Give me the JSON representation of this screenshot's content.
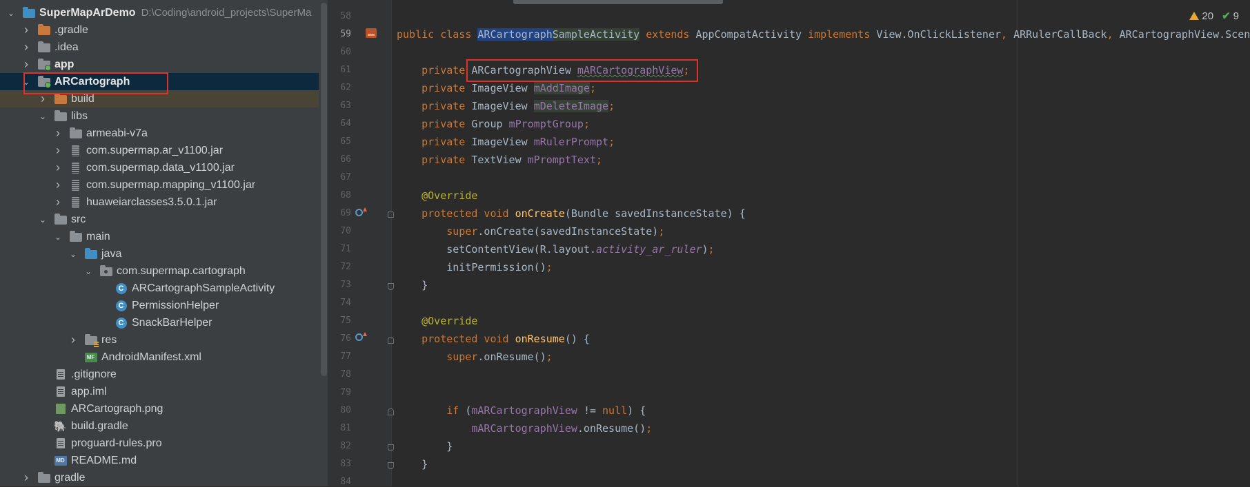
{
  "project_tree": {
    "rows": [
      {
        "label": "SuperMapArDemo",
        "path": "D:\\Coding\\android_projects\\SuperMa",
        "arrow": "down",
        "icon": "folder-blue-icon",
        "bold": true
      },
      {
        "label": ".gradle",
        "arrow": "right",
        "icon": "folder-orange-icon"
      },
      {
        "label": ".idea",
        "arrow": "right",
        "icon": "folder-grey-icon"
      },
      {
        "label": "app",
        "arrow": "right",
        "icon": "module-folder-icon",
        "bold": true
      },
      {
        "label": "ARCartograph",
        "arrow": "down",
        "icon": "module-folder-icon",
        "bold": true
      },
      {
        "label": "build",
        "arrow": "right",
        "icon": "folder-orange-icon"
      },
      {
        "label": "libs",
        "arrow": "down",
        "icon": "folder-grey-icon"
      },
      {
        "label": "armeabi-v7a",
        "arrow": "right",
        "icon": "folder-grey-icon"
      },
      {
        "label": "com.supermap.ar_v1100.jar",
        "arrow": "right",
        "icon": "jar-icon"
      },
      {
        "label": "com.supermap.data_v1100.jar",
        "arrow": "right",
        "icon": "jar-icon"
      },
      {
        "label": "com.supermap.mapping_v1100.jar",
        "arrow": "right",
        "icon": "jar-icon"
      },
      {
        "label": "huaweiarclasses3.5.0.1.jar",
        "arrow": "right",
        "icon": "jar-icon"
      },
      {
        "label": "src",
        "arrow": "down",
        "icon": "folder-grey-icon"
      },
      {
        "label": "main",
        "arrow": "down",
        "icon": "folder-grey-icon"
      },
      {
        "label": "java",
        "arrow": "down",
        "icon": "folder-blue-icon"
      },
      {
        "label": "com.supermap.cartograph",
        "arrow": "down",
        "icon": "package-icon"
      },
      {
        "label": "ARCartographSampleActivity",
        "arrow": "none",
        "icon": "class-icon"
      },
      {
        "label": "PermissionHelper",
        "arrow": "none",
        "icon": "class-icon"
      },
      {
        "label": "SnackBarHelper",
        "arrow": "none",
        "icon": "class-icon"
      },
      {
        "label": "res",
        "arrow": "right",
        "icon": "res-folder-icon"
      },
      {
        "label": "AndroidManifest.xml",
        "arrow": "none",
        "icon": "manifest-icon"
      },
      {
        "label": ".gitignore",
        "arrow": "none",
        "icon": "file-icon"
      },
      {
        "label": "app.iml",
        "arrow": "none",
        "icon": "file-icon"
      },
      {
        "label": "ARCartograph.png",
        "arrow": "none",
        "icon": "image-file-icon"
      },
      {
        "label": "build.gradle",
        "arrow": "none",
        "icon": "gradle-icon"
      },
      {
        "label": "proguard-rules.pro",
        "arrow": "none",
        "icon": "file-icon"
      },
      {
        "label": "README.md",
        "arrow": "none",
        "icon": "markdown-icon"
      },
      {
        "label": "gradle",
        "arrow": "right",
        "icon": "folder-grey-icon"
      }
    ],
    "icon_badges": {
      "mf": "MF",
      "md": "MD",
      "class": "C"
    }
  },
  "editor": {
    "inspections": {
      "warnings": "20",
      "ok": "9"
    },
    "lines": [
      {
        "n": "58",
        "tokens": []
      },
      {
        "n": "59",
        "tokens": [
          [
            "kw",
            "public class "
          ],
          [
            "sel",
            "ARCartograph"
          ],
          [
            "occ",
            "SampleActivity"
          ],
          [
            "kw",
            " extends "
          ],
          [
            "p",
            "AppCompatActivity "
          ],
          [
            "kw",
            "implements "
          ],
          [
            "p",
            "View.OnClickListener"
          ],
          [
            "kw",
            ", "
          ],
          [
            "p",
            "ARRulerCallBack"
          ],
          [
            "kw",
            ", "
          ],
          [
            "p",
            "ARCartographView.Scene"
          ]
        ]
      },
      {
        "n": "60",
        "tokens": []
      },
      {
        "n": "61",
        "tokens": [
          [
            "p",
            "    "
          ],
          [
            "kw",
            "private "
          ],
          [
            "p",
            "ARCartographView "
          ],
          [
            "fldw",
            "mARCartographView"
          ],
          [
            "kw",
            ";"
          ]
        ]
      },
      {
        "n": "62",
        "tokens": [
          [
            "p",
            "    "
          ],
          [
            "kw",
            "private "
          ],
          [
            "p",
            "ImageView "
          ],
          [
            "fldo",
            "mAddImage"
          ],
          [
            "kw",
            ";"
          ]
        ]
      },
      {
        "n": "63",
        "tokens": [
          [
            "p",
            "    "
          ],
          [
            "kw",
            "private "
          ],
          [
            "p",
            "ImageView "
          ],
          [
            "fldo",
            "mDeleteImage"
          ],
          [
            "kw",
            ";"
          ]
        ]
      },
      {
        "n": "64",
        "tokens": [
          [
            "p",
            "    "
          ],
          [
            "kw",
            "private "
          ],
          [
            "p",
            "Group "
          ],
          [
            "fld",
            "mPromptGroup"
          ],
          [
            "kw",
            ";"
          ]
        ]
      },
      {
        "n": "65",
        "tokens": [
          [
            "p",
            "    "
          ],
          [
            "kw",
            "private "
          ],
          [
            "p",
            "ImageView "
          ],
          [
            "fld",
            "mRulerPrompt"
          ],
          [
            "kw",
            ";"
          ]
        ]
      },
      {
        "n": "66",
        "tokens": [
          [
            "p",
            "    "
          ],
          [
            "kw",
            "private "
          ],
          [
            "p",
            "TextView "
          ],
          [
            "fld",
            "mPromptText"
          ],
          [
            "kw",
            ";"
          ]
        ]
      },
      {
        "n": "67",
        "tokens": []
      },
      {
        "n": "68",
        "tokens": [
          [
            "p",
            "    "
          ],
          [
            "ann",
            "@Override"
          ]
        ]
      },
      {
        "n": "69",
        "tokens": [
          [
            "p",
            "    "
          ],
          [
            "kw",
            "protected void "
          ],
          [
            "mth",
            "onCreate"
          ],
          [
            "p",
            "(Bundle savedInstanceState) {"
          ]
        ]
      },
      {
        "n": "70",
        "tokens": [
          [
            "p",
            "        "
          ],
          [
            "kw",
            "super"
          ],
          [
            "p",
            ".onCreate(savedInstanceState)"
          ],
          [
            "kw",
            ";"
          ]
        ]
      },
      {
        "n": "71",
        "tokens": [
          [
            "p",
            "        setContentView(R.layout."
          ],
          [
            "ital",
            "activity_ar_ruler"
          ],
          [
            "p",
            ")"
          ],
          [
            "kw",
            ";"
          ]
        ]
      },
      {
        "n": "72",
        "tokens": [
          [
            "p",
            "        initPermission()"
          ],
          [
            "kw",
            ";"
          ]
        ]
      },
      {
        "n": "73",
        "tokens": [
          [
            "p",
            "    }"
          ]
        ]
      },
      {
        "n": "74",
        "tokens": []
      },
      {
        "n": "75",
        "tokens": [
          [
            "p",
            "    "
          ],
          [
            "ann",
            "@Override"
          ]
        ]
      },
      {
        "n": "76",
        "tokens": [
          [
            "p",
            "    "
          ],
          [
            "kw",
            "protected void "
          ],
          [
            "mth",
            "onResume"
          ],
          [
            "p",
            "() {"
          ]
        ]
      },
      {
        "n": "77",
        "tokens": [
          [
            "p",
            "        "
          ],
          [
            "kw",
            "super"
          ],
          [
            "p",
            ".onResume()"
          ],
          [
            "kw",
            ";"
          ]
        ]
      },
      {
        "n": "78",
        "tokens": []
      },
      {
        "n": "79",
        "tokens": []
      },
      {
        "n": "80",
        "tokens": [
          [
            "p",
            "        "
          ],
          [
            "kw",
            "if "
          ],
          [
            "p",
            "("
          ],
          [
            "fld",
            "mARCartographView "
          ],
          [
            "p",
            "!= "
          ],
          [
            "kw",
            "null"
          ],
          [
            "p",
            ") {"
          ]
        ]
      },
      {
        "n": "81",
        "tokens": [
          [
            "p",
            "            "
          ],
          [
            "fld",
            "mARCartographView"
          ],
          [
            "p",
            ".onResume()"
          ],
          [
            "kw",
            ";"
          ]
        ]
      },
      {
        "n": "82",
        "tokens": [
          [
            "p",
            "        }"
          ]
        ]
      },
      {
        "n": "83",
        "tokens": [
          [
            "p",
            "    }"
          ]
        ]
      },
      {
        "n": "84",
        "tokens": []
      }
    ]
  }
}
